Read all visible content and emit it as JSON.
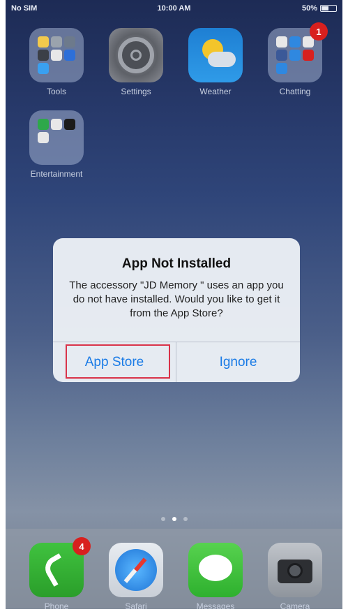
{
  "status": {
    "carrier": "No SIM",
    "time": "10:00 AM",
    "battery": "50%"
  },
  "home": {
    "apps": [
      {
        "label": "Tools"
      },
      {
        "label": "Settings"
      },
      {
        "label": "Weather"
      },
      {
        "label": "Chatting",
        "badge": "1"
      },
      {
        "label": "Entertainment"
      }
    ]
  },
  "dialog": {
    "title": "App Not Installed",
    "message": "The accessory \"JD Memory \" uses an app you do not have installed. Would you like to get it from the App Store?",
    "app_store_label": "App Store",
    "ignore_label": "Ignore"
  },
  "dock": {
    "apps": [
      {
        "label": "Phone",
        "badge": "4"
      },
      {
        "label": "Safari"
      },
      {
        "label": "Messages"
      },
      {
        "label": "Camera"
      }
    ]
  },
  "colors": {
    "accent": "#1a7be6",
    "badge": "#d8201e",
    "highlight": "#d9334a"
  }
}
